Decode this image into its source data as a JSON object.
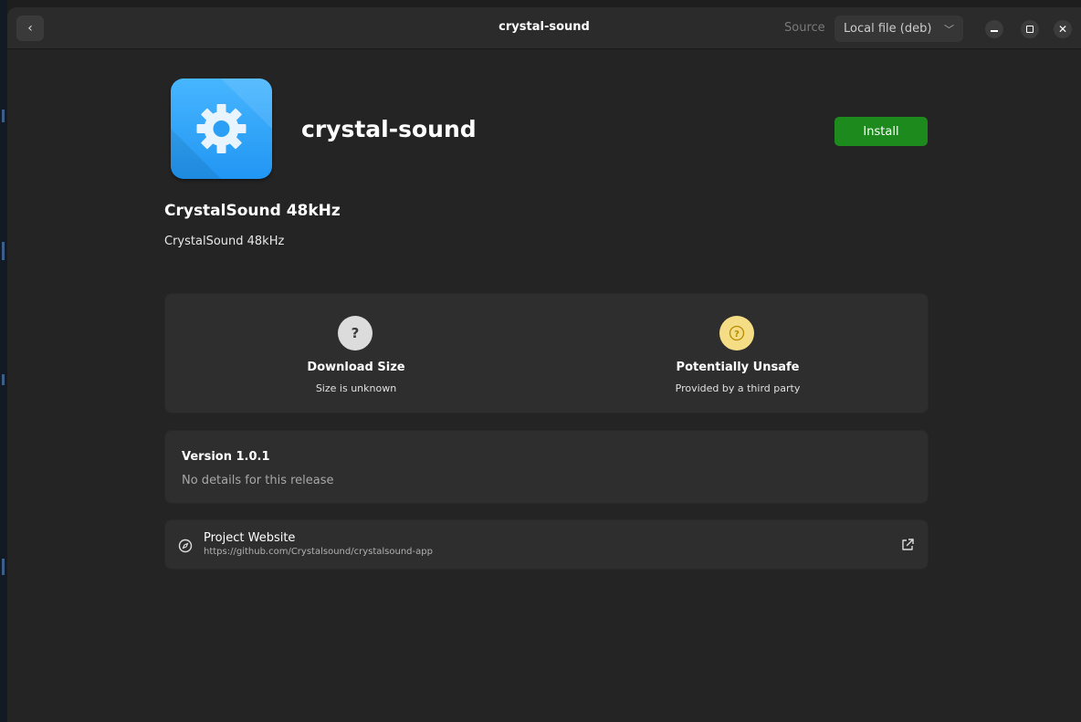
{
  "window": {
    "title": "crystal-sound",
    "back_glyph": "‹",
    "source_label": "Source",
    "source_value": "Local file (deb)",
    "controls": [
      "minimize-icon",
      "maximize-icon",
      "close-icon"
    ]
  },
  "app": {
    "name": "crystal-sound",
    "icon": "gear-icon",
    "install_label": "Install",
    "summary": "CrystalSound 48kHz",
    "description": "CrystalSound 48kHz"
  },
  "info_tiles": [
    {
      "icon": "question-icon",
      "glyph": "?",
      "title": "Download Size",
      "subtitle": "Size is unknown"
    },
    {
      "icon": "warning-icon",
      "glyph": "?",
      "title": "Potentially Unsafe",
      "subtitle": "Provided by a third party"
    }
  ],
  "version": {
    "title": "Version 1.0.1",
    "note": "No details for this release"
  },
  "links": {
    "project_website_label": "Project Website",
    "project_website_url": "https://github.com/Crystalsound/crystalsound-app"
  },
  "colors": {
    "accent_install": "#1d8a1d",
    "icon_blue": "#2196f3",
    "warning_yellow": "#f4dd85",
    "background": "#242424",
    "card": "#2e2e2e"
  }
}
